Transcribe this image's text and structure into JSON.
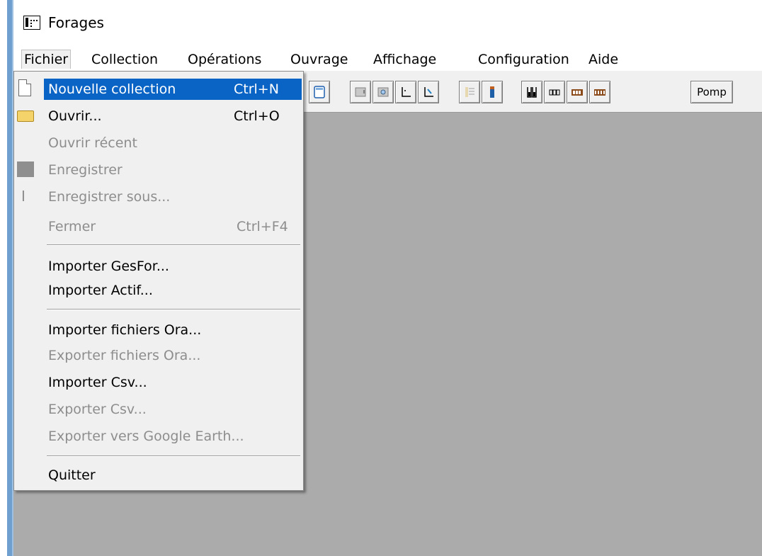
{
  "window": {
    "title": "Forages"
  },
  "menubar": {
    "items": [
      {
        "label": "Fichier"
      },
      {
        "label": "Collection"
      },
      {
        "label": "Opérations"
      },
      {
        "label": "Ouvrage"
      },
      {
        "label": "Affichage"
      },
      {
        "label": "Configuration"
      },
      {
        "label": "Aide"
      }
    ]
  },
  "toolbar": {
    "pomp_label": "Pomp"
  },
  "fichier_menu": {
    "items": [
      {
        "label": "Nouvelle collection",
        "shortcut": "Ctrl+N",
        "icon": "new-document-icon",
        "enabled": true,
        "highlighted": true
      },
      {
        "label": "Ouvrir...",
        "shortcut": "Ctrl+O",
        "icon": "folder-open-icon",
        "enabled": true
      },
      {
        "label": "Ouvrir récent",
        "enabled": false
      },
      {
        "label": "Enregistrer",
        "icon": "save-icon",
        "enabled": false
      },
      {
        "label": "Enregistrer sous...",
        "icon": "save-as-icon",
        "enabled": false
      },
      {
        "label": "Fermer",
        "shortcut": "Ctrl+F4",
        "enabled": false
      },
      {
        "label": "Importer GesFor...",
        "enabled": true
      },
      {
        "label": "Importer Actif...",
        "enabled": true
      },
      {
        "label": "Importer fichiers Ora...",
        "enabled": true
      },
      {
        "label": "Exporter fichiers Ora...",
        "enabled": false
      },
      {
        "label": "Importer Csv...",
        "enabled": true
      },
      {
        "label": "Exporter Csv...",
        "enabled": false
      },
      {
        "label": "Exporter vers Google Earth...",
        "enabled": false
      },
      {
        "label": "Quitter",
        "enabled": true
      }
    ]
  },
  "colors": {
    "highlight": "#0a64c6",
    "workspace": "#ababab",
    "window_border": "#6f9fcf",
    "disabled_text": "#8d8d8d"
  }
}
